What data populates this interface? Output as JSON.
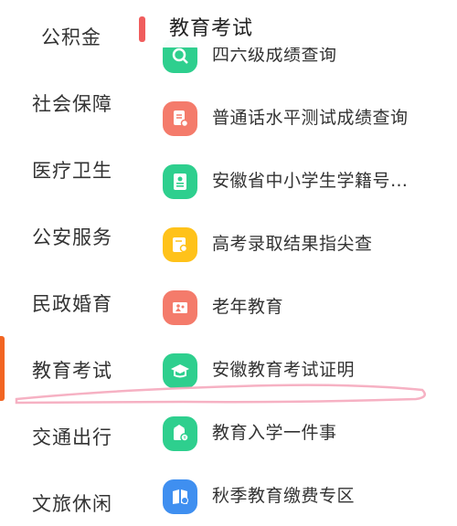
{
  "sidebar": {
    "items": [
      {
        "label": "公积金"
      },
      {
        "label": "社会保障"
      },
      {
        "label": "医疗卫生"
      },
      {
        "label": "公安服务"
      },
      {
        "label": "民政婚育"
      },
      {
        "label": "教育考试"
      },
      {
        "label": "交通出行"
      },
      {
        "label": "文旅休闲"
      }
    ],
    "active": "教育考试"
  },
  "section": {
    "title": "教育考试",
    "accent": "#f05d5d"
  },
  "services": [
    {
      "label": "四六级成绩查询",
      "icon": "search-doc-icon",
      "color": "#2ecf8e"
    },
    {
      "label": "普通话水平测试成绩查询",
      "icon": "document-search-icon",
      "color": "#f47b6b"
    },
    {
      "label": "安徽省中小学生学籍号…",
      "icon": "id-card-icon",
      "color": "#2ecf8e"
    },
    {
      "label": "高考录取结果指尖查",
      "icon": "certificate-icon",
      "color": "#ffc21a"
    },
    {
      "label": "老年教育",
      "icon": "elder-education-icon",
      "color": "#f47b6b"
    },
    {
      "label": "安徽教育考试证明",
      "icon": "graduation-cap-icon",
      "color": "#2ecf8e"
    },
    {
      "label": "教育入学一件事",
      "icon": "school-enroll-icon",
      "color": "#2ecf8e"
    },
    {
      "label": "秋季教育缴费专区",
      "icon": "book-payment-icon",
      "color": "#3f8ff0"
    }
  ]
}
